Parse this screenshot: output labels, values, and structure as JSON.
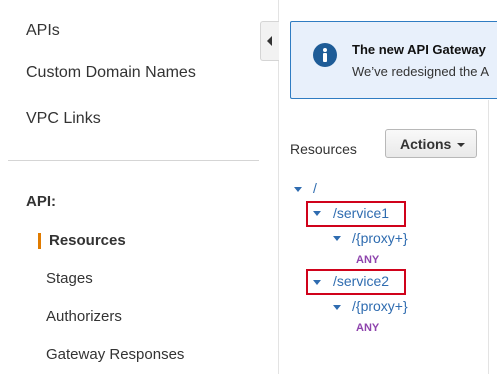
{
  "sidebar": {
    "items": [
      {
        "label": "APIs"
      },
      {
        "label": "Custom Domain Names"
      },
      {
        "label": "VPC Links"
      }
    ],
    "section_label": "API:",
    "sub_items": [
      {
        "label": "Resources",
        "active": true
      },
      {
        "label": "Stages"
      },
      {
        "label": "Authorizers"
      },
      {
        "label": "Gateway Responses"
      }
    ]
  },
  "banner": {
    "title": "The new API Gateway",
    "text": "We’ve redesigned the A"
  },
  "main": {
    "resources_label": "Resources",
    "actions_label": "Actions"
  },
  "tree": {
    "root": "/",
    "service1": "/service1",
    "proxy1": "/{proxy+}",
    "method1": "ANY",
    "service2": "/service2",
    "proxy2": "/{proxy+}",
    "method2": "ANY"
  },
  "colors": {
    "accent": "#e07b00",
    "link": "#2f6cb0",
    "method": "#8e44ad",
    "highlight": "#d0021b",
    "banner_bg": "#e8f0fb",
    "banner_border": "#2f7cc2"
  },
  "icons": {
    "banner": "info-icon",
    "collapse": "chevron-left-icon",
    "actions": "caret-down-icon",
    "tree": "tree-expand-arrow-icon"
  }
}
